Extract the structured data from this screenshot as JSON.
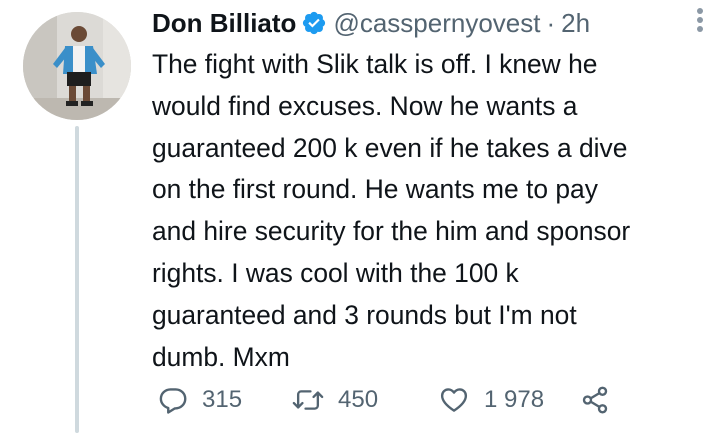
{
  "author": {
    "name": "Don Billiato",
    "handle": "@casspernyovest",
    "separator": "·",
    "time": "2h"
  },
  "icons": {
    "verified": "verified-badge-icon",
    "more": "more-options-icon",
    "reply": "reply-icon",
    "retweet": "retweet-icon",
    "like": "like-heart-icon",
    "share": "share-icon"
  },
  "tweet": {
    "text": "The fight with Slik talk is off. I knew he\nwould find excuses. Now he wants a\nguaranteed 200 k even if he takes a dive\non the first round. He wants me to pay\nand hire security for the him and sponsor\nrights. I was cool with the 100 k\nguaranteed and 3 rounds but I'm not\ndumb. Mxm"
  },
  "stats": {
    "replies": "315",
    "retweets": "450",
    "likes": "1 978"
  },
  "colors": {
    "verified_blue": "#1d9bf0",
    "secondary_text": "#536471",
    "thread_line": "#cfd9de",
    "primary_text": "#0f1419"
  }
}
